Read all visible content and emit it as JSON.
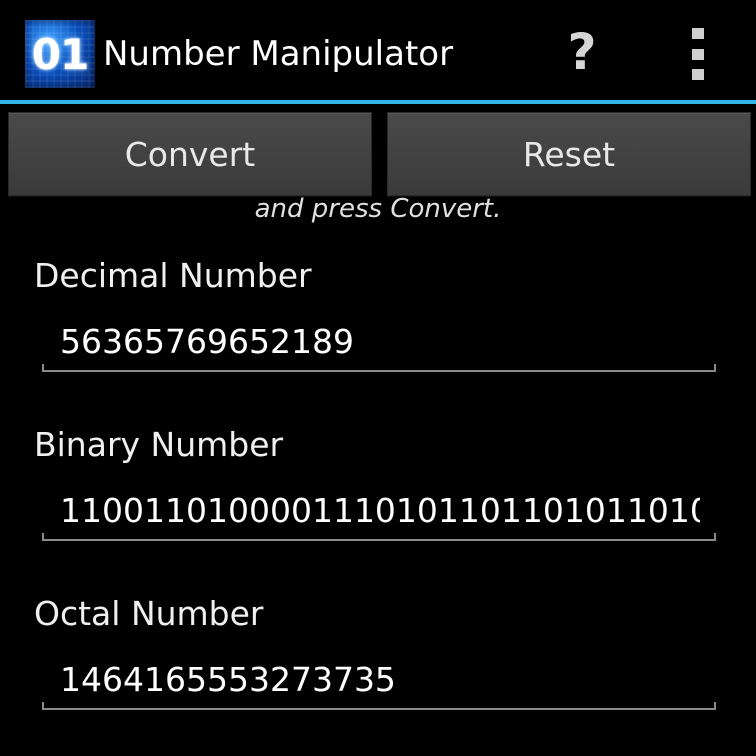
{
  "app": {
    "icon_text": "01",
    "title": "Number Manipulator",
    "help_label": "?"
  },
  "buttons": {
    "convert_label": "Convert",
    "reset_label": "Reset"
  },
  "instruction": "and press Convert.",
  "fields": [
    {
      "label": "Decimal Number",
      "value": "56365769652189"
    },
    {
      "label": "Binary Number",
      "value": "1100110100001110101101101011010"
    },
    {
      "label": "Octal Number",
      "value": "1464165553273735"
    }
  ],
  "colors": {
    "accent": "#33b5e5",
    "background": "#000000",
    "button": "#424242"
  }
}
